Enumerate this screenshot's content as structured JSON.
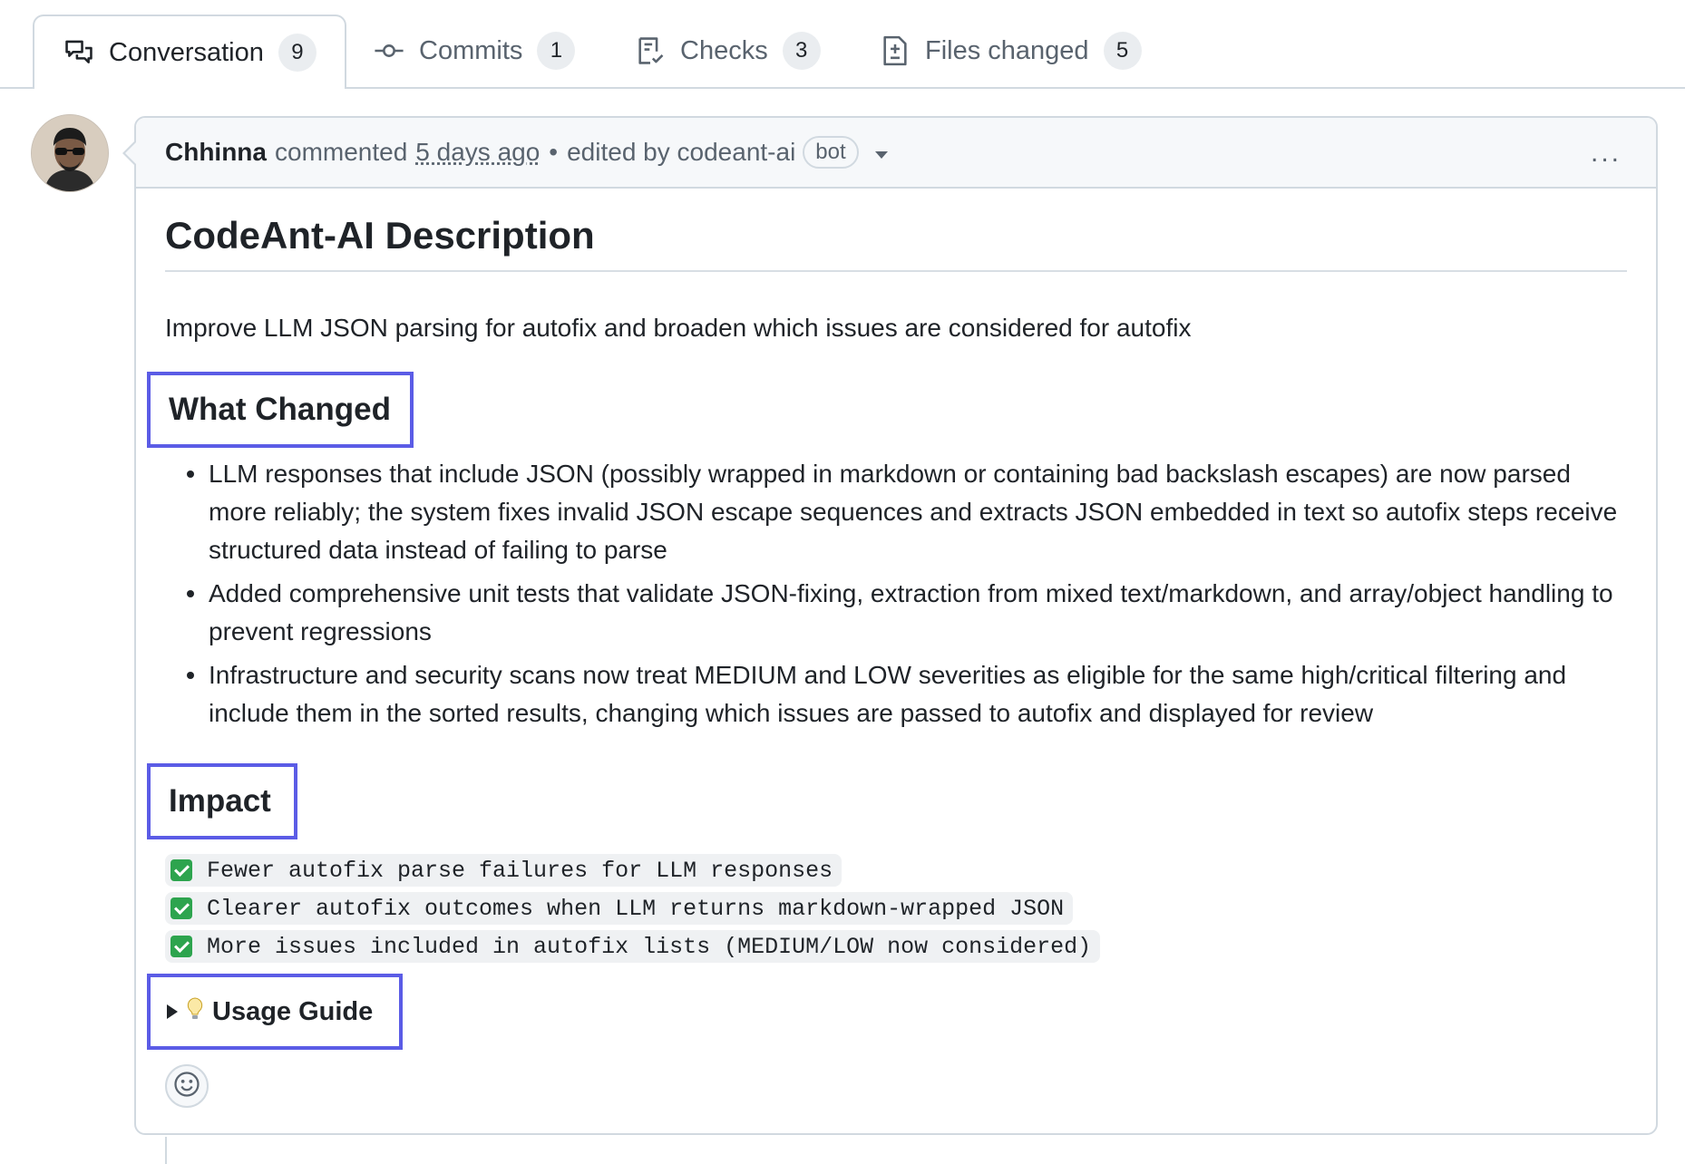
{
  "tabs": [
    {
      "label": "Conversation",
      "count": "9",
      "icon": "comment-discussion-icon"
    },
    {
      "label": "Commits",
      "count": "1",
      "icon": "git-commit-icon"
    },
    {
      "label": "Checks",
      "count": "3",
      "icon": "checklist-icon"
    },
    {
      "label": "Files changed",
      "count": "5",
      "icon": "file-diff-icon"
    }
  ],
  "comment": {
    "author": "Chhinna",
    "action": "commented",
    "time": "5 days ago",
    "separator": "•",
    "edited": "edited by codeant-ai",
    "bot_label": "bot",
    "menu": "..."
  },
  "body": {
    "title": "CodeAnt-AI Description",
    "description": "Improve LLM JSON parsing for autofix and broaden which issues are considered for autofix",
    "what_changed": {
      "heading": "What Changed",
      "items": [
        "LLM responses that include JSON (possibly wrapped in markdown or containing bad backslash escapes) are now parsed more reliably; the system fixes invalid JSON escape sequences and extracts JSON embedded in text so autofix steps receive structured data instead of failing to parse",
        "Added comprehensive unit tests that validate JSON-fixing, extraction from mixed text/markdown, and array/object handling to prevent regressions",
        "Infrastructure and security scans now treat MEDIUM and LOW severities as eligible for the same high/critical filtering and include them in the sorted results, changing which issues are passed to autofix and displayed for review"
      ]
    },
    "impact": {
      "heading": "Impact",
      "items": [
        "Fewer autofix parse failures for LLM responses",
        "Clearer autofix outcomes when LLM returns markdown-wrapped JSON",
        "More issues included in autofix lists (MEDIUM/LOW now considered)"
      ]
    },
    "usage_guide": "Usage Guide"
  },
  "colors": {
    "highlight_box": "#5b5ce6",
    "check_green": "#2da44e"
  }
}
